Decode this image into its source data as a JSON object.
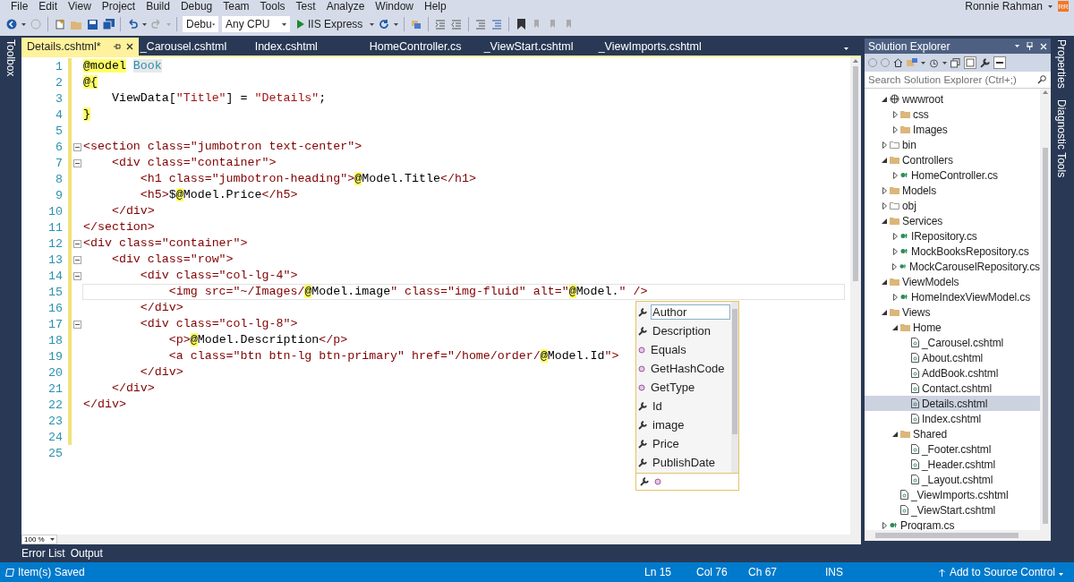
{
  "menu": [
    "File",
    "Edit",
    "View",
    "Project",
    "Build",
    "Debug",
    "Team",
    "Tools",
    "Test",
    "Analyze",
    "Window",
    "Help"
  ],
  "user": {
    "name": "Ronnie Rahman",
    "initials": "RR"
  },
  "toolbar": {
    "configuration": "Debu",
    "platform": "Any CPU",
    "run_target": "IIS Express"
  },
  "left_strip": [
    "Toolbox"
  ],
  "right_strip": [
    "Properties",
    "Diagnostic Tools"
  ],
  "editor_tabs": [
    {
      "label": "Details.cshtml*",
      "selected": true
    },
    {
      "label": "_Carousel.cshtml",
      "selected": false
    },
    {
      "label": "Index.cshtml",
      "selected": false
    },
    {
      "label": "HomeController.cs",
      "selected": false
    },
    {
      "label": "_ViewStart.cshtml",
      "selected": false
    },
    {
      "label": "_ViewImports.cshtml",
      "selected": false
    }
  ],
  "code_lines": [
    {
      "number": "1",
      "changed": true,
      "fold": false,
      "current": false,
      "tokens": [
        {
          "kind": "razor",
          "text": "@model"
        },
        {
          "kind": "type",
          "text": "Book"
        }
      ]
    },
    {
      "number": "2",
      "changed": true,
      "fold": false,
      "current": false,
      "tokens": [
        {
          "kind": "razor",
          "text": "@{"
        }
      ]
    },
    {
      "number": "3",
      "changed": true,
      "fold": false,
      "current": false,
      "tokens": [
        {
          "kind": "plain",
          "text": "    ViewData["
        },
        {
          "kind": "string",
          "text": "\"Title\""
        },
        {
          "kind": "plain",
          "text": "] = "
        },
        {
          "kind": "string",
          "text": "\"Details\""
        },
        {
          "kind": "plain",
          "text": ";"
        }
      ]
    },
    {
      "number": "4",
      "changed": true,
      "fold": false,
      "current": false,
      "tokens": [
        {
          "kind": "razor",
          "text": "}"
        }
      ]
    },
    {
      "number": "5",
      "changed": true,
      "fold": false,
      "current": false
    },
    {
      "number": "6",
      "changed": true,
      "fold": true,
      "current": false,
      "tokens": [
        {
          "kind": "markup",
          "text": "<section class=\"jumbotron text-center\">"
        }
      ]
    },
    {
      "number": "7",
      "changed": true,
      "fold": true,
      "current": false,
      "tokens": [
        {
          "kind": "markup",
          "text": "    <div class=\"container\">"
        }
      ]
    },
    {
      "number": "8",
      "changed": true,
      "fold": false,
      "current": false,
      "tokens": [
        {
          "kind": "markup",
          "text": "        <h1 class=\"jumbotron-heading\">"
        },
        {
          "kind": "razor",
          "text": "@"
        },
        {
          "kind": "plain",
          "text": "Model.Title"
        },
        {
          "kind": "markup",
          "text": "</h1>"
        }
      ]
    },
    {
      "number": "9",
      "changed": true,
      "fold": false,
      "current": false,
      "tokens": [
        {
          "kind": "markup",
          "text": "        <h5>"
        },
        {
          "kind": "plain",
          "text": "$"
        },
        {
          "kind": "razor",
          "text": "@"
        },
        {
          "kind": "plain",
          "text": "Model.Price"
        },
        {
          "kind": "markup",
          "text": "</h5>"
        }
      ]
    },
    {
      "number": "10",
      "changed": true,
      "fold": false,
      "current": false,
      "tokens": [
        {
          "kind": "markup",
          "text": "    </div>"
        }
      ]
    },
    {
      "number": "11",
      "changed": true,
      "fold": false,
      "current": false,
      "tokens": [
        {
          "kind": "markup",
          "text": "</section>"
        }
      ]
    },
    {
      "number": "12",
      "changed": true,
      "fold": true,
      "current": false,
      "tokens": [
        {
          "kind": "markup",
          "text": "<div class=\"container\">"
        }
      ]
    },
    {
      "number": "13",
      "changed": true,
      "fold": true,
      "current": false,
      "tokens": [
        {
          "kind": "markup",
          "text": "    <div class=\"row\">"
        }
      ]
    },
    {
      "number": "14",
      "changed": true,
      "fold": true,
      "current": false,
      "tokens": [
        {
          "kind": "markup",
          "text": "        <div class=\"col-lg-4\">"
        }
      ]
    },
    {
      "number": "15",
      "changed": true,
      "fold": false,
      "current": true,
      "tokens": [
        {
          "kind": "markup",
          "text": "            <img src=\"~/Images/"
        },
        {
          "kind": "razor",
          "text": "@"
        },
        {
          "kind": "plain",
          "text": "Model.image"
        },
        {
          "kind": "markup",
          "text": "\" class=\"img-fluid\" alt=\""
        },
        {
          "kind": "razor",
          "text": "@"
        },
        {
          "kind": "plain",
          "text": "Model."
        },
        {
          "kind": "markup",
          "text": "\" />"
        }
      ]
    },
    {
      "number": "16",
      "changed": true,
      "fold": false,
      "current": false,
      "tokens": [
        {
          "kind": "markup",
          "text": "        </div>"
        }
      ]
    },
    {
      "number": "17",
      "changed": true,
      "fold": true,
      "current": false,
      "tokens": [
        {
          "kind": "markup",
          "text": "        <div class=\"col-lg-8\">"
        }
      ]
    },
    {
      "number": "18",
      "changed": true,
      "fold": false,
      "current": false,
      "tokens": [
        {
          "kind": "markup",
          "text": "            <p>"
        },
        {
          "kind": "razor",
          "text": "@"
        },
        {
          "kind": "plain",
          "text": "Model.Description"
        },
        {
          "kind": "markup",
          "text": "</p>"
        }
      ]
    },
    {
      "number": "19",
      "changed": true,
      "fold": false,
      "current": false,
      "tokens": [
        {
          "kind": "markup",
          "text": "            <a class=\"btn btn-lg btn-primary\" href=\"/home/order/"
        },
        {
          "kind": "razor",
          "text": "@"
        },
        {
          "kind": "plain",
          "text": "Model.Id"
        },
        {
          "kind": "markup",
          "text": "\">"
        }
      ]
    },
    {
      "number": "20",
      "changed": true,
      "fold": false,
      "current": false,
      "tokens": [
        {
          "kind": "markup",
          "text": "        </div>"
        }
      ]
    },
    {
      "number": "21",
      "changed": true,
      "fold": false,
      "current": false,
      "tokens": [
        {
          "kind": "markup",
          "text": "    </div>"
        }
      ]
    },
    {
      "number": "22",
      "changed": true,
      "fold": false,
      "current": false,
      "tokens": [
        {
          "kind": "markup",
          "text": "</div>"
        }
      ]
    },
    {
      "number": "23",
      "changed": true,
      "fold": false,
      "current": false
    },
    {
      "number": "24",
      "changed": true,
      "fold": false,
      "current": false
    },
    {
      "number": "25",
      "changed": false,
      "fold": false,
      "current": false
    }
  ],
  "completion": [
    {
      "label": "Author",
      "kind": "property",
      "selected": true
    },
    {
      "label": "Description",
      "kind": "property",
      "selected": false
    },
    {
      "label": "Equals",
      "kind": "method",
      "selected": false
    },
    {
      "label": "GetHashCode",
      "kind": "method",
      "selected": false
    },
    {
      "label": "GetType",
      "kind": "method",
      "selected": false
    },
    {
      "label": "Id",
      "kind": "property",
      "selected": false
    },
    {
      "label": "image",
      "kind": "property",
      "selected": false
    },
    {
      "label": "Price",
      "kind": "property",
      "selected": false
    },
    {
      "label": "PublishDate",
      "kind": "property",
      "selected": false
    }
  ],
  "zoom_level": "100 %",
  "solution_explorer": {
    "title": "Solution Explorer",
    "search_placeholder": "Search Solution Explorer (Ctrl+;)",
    "tree": [
      {
        "label": "wwwroot",
        "kind": "web",
        "expanded": true,
        "selected": false,
        "children": [
          {
            "label": "css",
            "kind": "folder",
            "expanded": false,
            "selected": false
          },
          {
            "label": "Images",
            "kind": "folder",
            "expanded": false,
            "selected": false
          }
        ]
      },
      {
        "label": "bin",
        "kind": "hidden-folder",
        "expanded": false,
        "selected": false
      },
      {
        "label": "Controllers",
        "kind": "folder",
        "expanded": true,
        "selected": false,
        "children": [
          {
            "label": "HomeController.cs",
            "kind": "csharp",
            "expanded": false,
            "selected": false
          }
        ]
      },
      {
        "label": "Models",
        "kind": "folder",
        "expanded": false,
        "selected": false
      },
      {
        "label": "obj",
        "kind": "hidden-folder",
        "expanded": false,
        "selected": false
      },
      {
        "label": "Services",
        "kind": "folder",
        "expanded": true,
        "selected": false,
        "children": [
          {
            "label": "IRepository.cs",
            "kind": "csharp",
            "expanded": false,
            "selected": false
          },
          {
            "label": "MockBooksRepository.cs",
            "kind": "csharp",
            "expanded": false,
            "selected": false
          },
          {
            "label": "MockCarouselRepository.cs",
            "kind": "csharp",
            "expanded": false,
            "selected": false
          }
        ]
      },
      {
        "label": "ViewModels",
        "kind": "folder",
        "expanded": true,
        "selected": false,
        "children": [
          {
            "label": "HomeIndexViewModel.cs",
            "kind": "csharp",
            "expanded": false,
            "selected": false
          }
        ]
      },
      {
        "label": "Views",
        "kind": "folder",
        "expanded": true,
        "selected": false,
        "children": [
          {
            "label": "Home",
            "kind": "folder",
            "expanded": true,
            "selected": false,
            "children": [
              {
                "label": "_Carousel.cshtml",
                "kind": "page",
                "selected": false
              },
              {
                "label": "About.cshtml",
                "kind": "page",
                "selected": false
              },
              {
                "label": "AddBook.cshtml",
                "kind": "page",
                "selected": false
              },
              {
                "label": "Contact.cshtml",
                "kind": "page",
                "selected": false
              },
              {
                "label": "Details.cshtml",
                "kind": "page",
                "selected": true
              },
              {
                "label": "Index.cshtml",
                "kind": "page",
                "selected": false
              }
            ]
          },
          {
            "label": "Shared",
            "kind": "folder",
            "expanded": true,
            "selected": false,
            "children": [
              {
                "label": "_Footer.cshtml",
                "kind": "page",
                "selected": false
              },
              {
                "label": "_Header.cshtml",
                "kind": "page",
                "selected": false
              },
              {
                "label": "_Layout.cshtml",
                "kind": "page",
                "selected": false
              }
            ]
          },
          {
            "label": "_ViewImports.cshtml",
            "kind": "page",
            "selected": false
          },
          {
            "label": "_ViewStart.cshtml",
            "kind": "page",
            "selected": false
          }
        ]
      },
      {
        "label": "Program.cs",
        "kind": "csharp",
        "expanded": false,
        "selected": false
      }
    ]
  },
  "bottom_tabs": [
    "Error List",
    "Output"
  ],
  "status_bar": {
    "message": "Item(s) Saved",
    "line": "Ln 15",
    "column": "Col 76",
    "char": "Ch 67",
    "mode": "INS",
    "source_control": "Add to Source Control"
  }
}
